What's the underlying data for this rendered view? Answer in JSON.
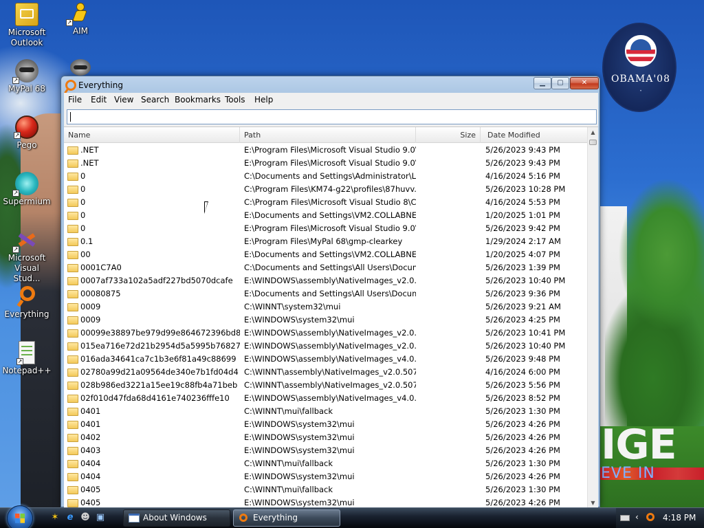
{
  "desktop": {
    "icons": [
      {
        "label": "Microsoft Outlook",
        "icon": "outlook-icon"
      },
      {
        "label": "AIM",
        "icon": "aim-running-man-icon"
      },
      {
        "label": "MyPal 68",
        "icon": "mypal-raccoon-icon"
      },
      {
        "label": "Pego",
        "icon": "pego-red-ball-icon"
      },
      {
        "label": "Supermium",
        "icon": "supermium-icon"
      },
      {
        "label": "Microsoft Visual Stud...",
        "icon": "visual-studio-icon"
      },
      {
        "label": "Everything",
        "icon": "everything-icon"
      },
      {
        "label": "Notepad++",
        "icon": "notepadpp-icon"
      }
    ],
    "badge": {
      "text": "OBAMA'08"
    },
    "slogan": {
      "big": "IGE",
      "small": "EVE IN"
    }
  },
  "window": {
    "title": "Everything",
    "menu": [
      "File",
      "Edit",
      "View",
      "Search",
      "Bookmarks",
      "Tools",
      "Help"
    ],
    "search": {
      "value": "",
      "placeholder": ""
    },
    "columns": {
      "name": "Name",
      "path": "Path",
      "size": "Size",
      "date": "Date Modified"
    },
    "rows": [
      {
        "name": ".NET",
        "path": "E:\\Program Files\\Microsoft Visual Studio 9.0\\...",
        "size": "",
        "date": "5/26/2023 9:43 PM"
      },
      {
        "name": ".NET",
        "path": "E:\\Program Files\\Microsoft Visual Studio 9.0\\...",
        "size": "",
        "date": "5/26/2023 9:43 PM"
      },
      {
        "name": "0",
        "path": "C:\\Documents and Settings\\Administrator\\L...",
        "size": "",
        "date": "4/16/2024 5:16 PM"
      },
      {
        "name": "0",
        "path": "C:\\Program Files\\KM74-g22\\profiles\\87huvv...",
        "size": "",
        "date": "5/26/2023 10:28 PM"
      },
      {
        "name": "0",
        "path": "C:\\Program Files\\Microsoft Visual Studio 8\\C...",
        "size": "",
        "date": "4/16/2024 5:53 PM"
      },
      {
        "name": "0",
        "path": "E:\\Documents and Settings\\VM2.COLLABNE...",
        "size": "",
        "date": "1/20/2025 1:01 PM"
      },
      {
        "name": "0",
        "path": "E:\\Program Files\\Microsoft Visual Studio 9.0\\...",
        "size": "",
        "date": "5/26/2023 9:42 PM"
      },
      {
        "name": "0.1",
        "path": "E:\\Program Files\\MyPal 68\\gmp-clearkey",
        "size": "",
        "date": "1/29/2024 2:17 AM"
      },
      {
        "name": "00",
        "path": "E:\\Documents and Settings\\VM2.COLLABNE...",
        "size": "",
        "date": "1/20/2025 4:07 PM"
      },
      {
        "name": "0001C7A0",
        "path": "C:\\Documents and Settings\\All Users\\Docum...",
        "size": "",
        "date": "5/26/2023 1:39 PM"
      },
      {
        "name": "0007af733a102a5adf227bd5070dcafe",
        "path": "E:\\WINDOWS\\assembly\\NativeImages_v2.0.5...",
        "size": "",
        "date": "5/26/2023 10:40 PM"
      },
      {
        "name": "00080875",
        "path": "E:\\Documents and Settings\\All Users\\Docum...",
        "size": "",
        "date": "5/26/2023 9:36 PM"
      },
      {
        "name": "0009",
        "path": "C:\\WINNT\\system32\\mui",
        "size": "",
        "date": "5/26/2023 9:21 AM"
      },
      {
        "name": "0009",
        "path": "E:\\WINDOWS\\system32\\mui",
        "size": "",
        "date": "5/26/2023 4:25 PM"
      },
      {
        "name": "00099e38897be979d99e864672396bd8",
        "path": "E:\\WINDOWS\\assembly\\NativeImages_v2.0.5...",
        "size": "",
        "date": "5/26/2023 10:41 PM"
      },
      {
        "name": "015ea716e72d21b2954d5a5995b76827",
        "path": "E:\\WINDOWS\\assembly\\NativeImages_v2.0.5...",
        "size": "",
        "date": "5/26/2023 10:40 PM"
      },
      {
        "name": "016ada34641ca7c1b3e6f81a49c88699",
        "path": "E:\\WINDOWS\\assembly\\NativeImages_v4.0.3...",
        "size": "",
        "date": "5/26/2023 9:48 PM"
      },
      {
        "name": "02780a99d21a09564de340e7b1fd04d4",
        "path": "C:\\WINNT\\assembly\\NativeImages_v2.0.5072...",
        "size": "",
        "date": "4/16/2024 6:00 PM"
      },
      {
        "name": "028b986ed3221a15ee19c88fb4a71beb",
        "path": "C:\\WINNT\\assembly\\NativeImages_v2.0.5072...",
        "size": "",
        "date": "5/26/2023 5:56 PM"
      },
      {
        "name": "02f010d47fda68d4161e740236fffe10",
        "path": "E:\\WINDOWS\\assembly\\NativeImages_v4.0.3...",
        "size": "",
        "date": "5/26/2023 8:52 PM"
      },
      {
        "name": "0401",
        "path": "C:\\WINNT\\mui\\fallback",
        "size": "",
        "date": "5/26/2023 1:30 PM"
      },
      {
        "name": "0401",
        "path": "E:\\WINDOWS\\system32\\mui",
        "size": "",
        "date": "5/26/2023 4:26 PM"
      },
      {
        "name": "0402",
        "path": "E:\\WINDOWS\\system32\\mui",
        "size": "",
        "date": "5/26/2023 4:26 PM"
      },
      {
        "name": "0403",
        "path": "E:\\WINDOWS\\system32\\mui",
        "size": "",
        "date": "5/26/2023 4:26 PM"
      },
      {
        "name": "0404",
        "path": "C:\\WINNT\\mui\\fallback",
        "size": "",
        "date": "5/26/2023 1:30 PM"
      },
      {
        "name": "0404",
        "path": "E:\\WINDOWS\\system32\\mui",
        "size": "",
        "date": "5/26/2023 4:26 PM"
      },
      {
        "name": "0405",
        "path": "C:\\WINNT\\mui\\fallback",
        "size": "",
        "date": "5/26/2023 1:30 PM"
      },
      {
        "name": "0405",
        "path": "E:\\WINDOWS\\system32\\mui",
        "size": "",
        "date": "5/26/2023 4:26 PM"
      }
    ]
  },
  "taskbar": {
    "quick_launch": [
      "aim-icon",
      "internet-explorer-icon",
      "mypal-icon",
      "show-desktop-icon"
    ],
    "buttons": [
      {
        "label": "About Windows",
        "icon": "window-icon"
      },
      {
        "label": "Everything",
        "icon": "everything-icon"
      }
    ],
    "tray": {
      "clock": "4:18 PM"
    }
  },
  "colors": {
    "accent": "#ee7a10",
    "window_frame": "#a8c4e2",
    "taskbar": "#1a2230"
  }
}
